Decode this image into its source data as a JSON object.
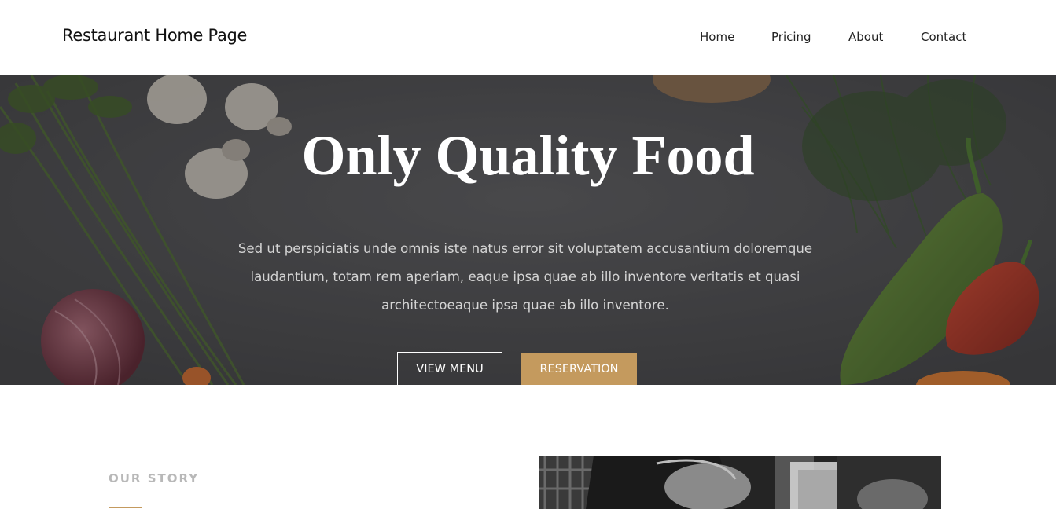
{
  "header": {
    "brand": "Restaurant Home Page",
    "nav": [
      {
        "label": "Home"
      },
      {
        "label": "Pricing"
      },
      {
        "label": "About"
      },
      {
        "label": "Contact"
      }
    ]
  },
  "hero": {
    "title": "Only Quality Food",
    "text": "Sed ut perspiciatis unde omnis iste natus error sit voluptatem accusantium doloremque laudantium, totam rem aperiam, eaque ipsa quae ab illo inventore veritatis et quasi architectoeaque ipsa quae ab illo inventore.",
    "buttons": {
      "view_menu": "VIEW MENU",
      "reservation": "RESERVATION"
    }
  },
  "story": {
    "label": "OUR STORY"
  },
  "colors": {
    "accent": "#c49a5e",
    "hero_overlay": "#4a4a4c"
  }
}
